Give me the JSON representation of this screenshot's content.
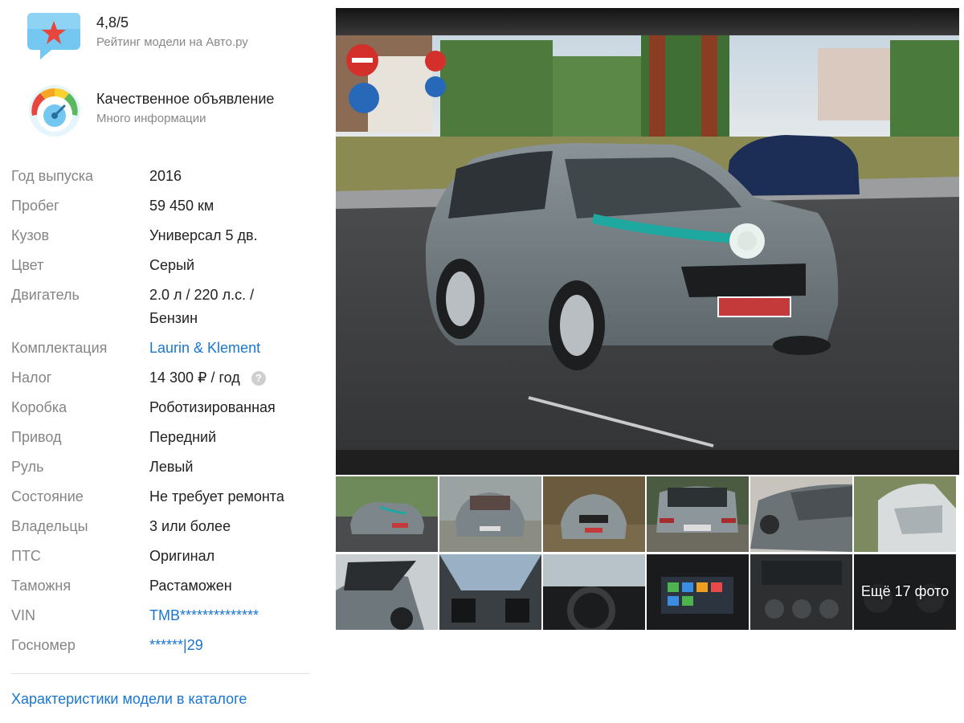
{
  "rating_badge": {
    "value": "4,8/5",
    "caption": "Рейтинг модели на Авто.ру"
  },
  "quality_badge": {
    "title": "Качественное объявление",
    "caption": "Много информации"
  },
  "specs": [
    {
      "label": "Год выпуска",
      "value": "2016"
    },
    {
      "label": "Пробег",
      "value": "59 450 км"
    },
    {
      "label": "Кузов",
      "value": "Универсал 5 дв."
    },
    {
      "label": "Цвет",
      "value": "Серый"
    },
    {
      "label": "Двигатель",
      "value": "2.0 л / 220 л.с. / Бензин"
    },
    {
      "label": "Комплектация",
      "value": "Laurin & Klement"
    },
    {
      "label": "Налог",
      "value": "14 300 ₽ / год"
    },
    {
      "label": "Коробка",
      "value": "Роботизированная"
    },
    {
      "label": "Привод",
      "value": "Передний"
    },
    {
      "label": "Руль",
      "value": "Левый"
    },
    {
      "label": "Состояние",
      "value": "Не требует ремонта"
    },
    {
      "label": "Владельцы",
      "value": "3 или более"
    },
    {
      "label": "ПТС",
      "value": "Оригинал"
    },
    {
      "label": "Таможня",
      "value": "Растаможен"
    },
    {
      "label": "VIN",
      "value": "TMB**************"
    },
    {
      "label": "Госномер",
      "value": "******|29"
    }
  ],
  "tax_help_icon": "?",
  "catalog_link": "Характеристики модели в каталоге",
  "gallery": {
    "more_photos_label": "Ещё 17 фото"
  },
  "colors": {
    "link": "#1976d2",
    "label": "#858585",
    "rating_star": "#e8453c",
    "rating_bubble": "#74c7f0"
  },
  "icons": [
    "star-bubble-icon",
    "quality-gauge-icon",
    "help-icon"
  ]
}
